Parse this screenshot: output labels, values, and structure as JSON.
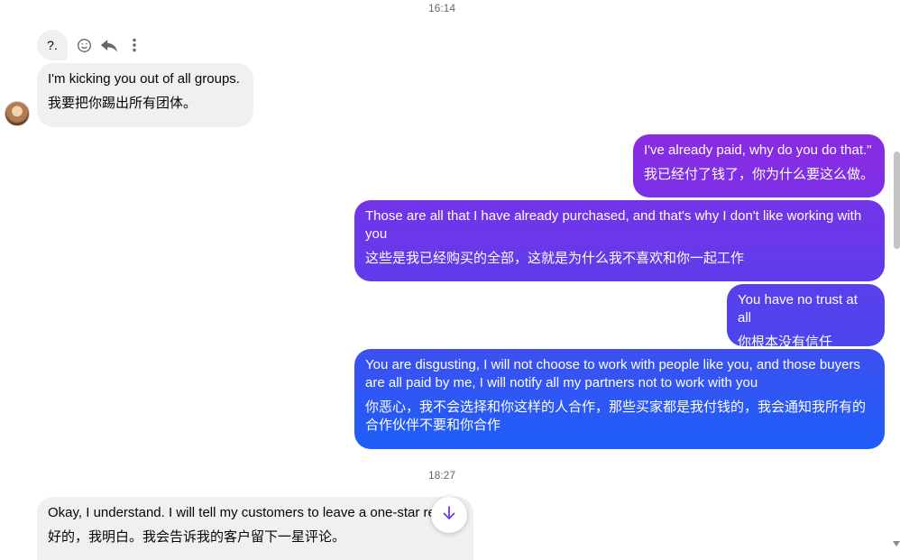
{
  "timestamps": [
    "16:14",
    "18:27"
  ],
  "reply_preview": {
    "text": "?."
  },
  "hover_actions": {
    "react_icon": "smiley-icon",
    "reply_icon": "reply-icon",
    "more_icon": "more-vertical-icon"
  },
  "messages": [
    {
      "direction": "incoming",
      "en": "I'm kicking you out of all groups.",
      "zh": "我要把你踢出所有团体。"
    },
    {
      "direction": "outgoing",
      "en": "I've already paid, why do you do that.\"",
      "zh": "我已经付了钱了，你为什么要这么做。"
    },
    {
      "direction": "outgoing",
      "en": "Those are all that I have already purchased, and that's why I don't like working with you",
      "zh": "这些是我已经购买的全部，这就是为什么我不喜欢和你一起工作"
    },
    {
      "direction": "outgoing",
      "en": "You have no trust at all",
      "zh": "你根本没有信任"
    },
    {
      "direction": "outgoing",
      "en": "You are disgusting, I will not choose to work with people like you, and those buyers are all paid by me, I will notify all my partners not to work with you",
      "zh": "你恶心，我不会选择和你这样的人合作，那些买家都是我付钱的，我会通知我所有的合作伙伴不要和你合作"
    },
    {
      "direction": "incoming",
      "en": "Okay, I understand. I will tell my customers to leave a one-star re",
      "zh": "好的，我明白。我会告诉我的客户留下一星评论。"
    }
  ],
  "scroll_down_icon": "arrow-down-icon",
  "colors": {
    "incoming_bubble": "#f0f0f0",
    "outgoing_gradient_top": "#8a2be2",
    "outgoing_gradient_bottom": "#1e5ef7",
    "accent": "#6a3de8"
  }
}
